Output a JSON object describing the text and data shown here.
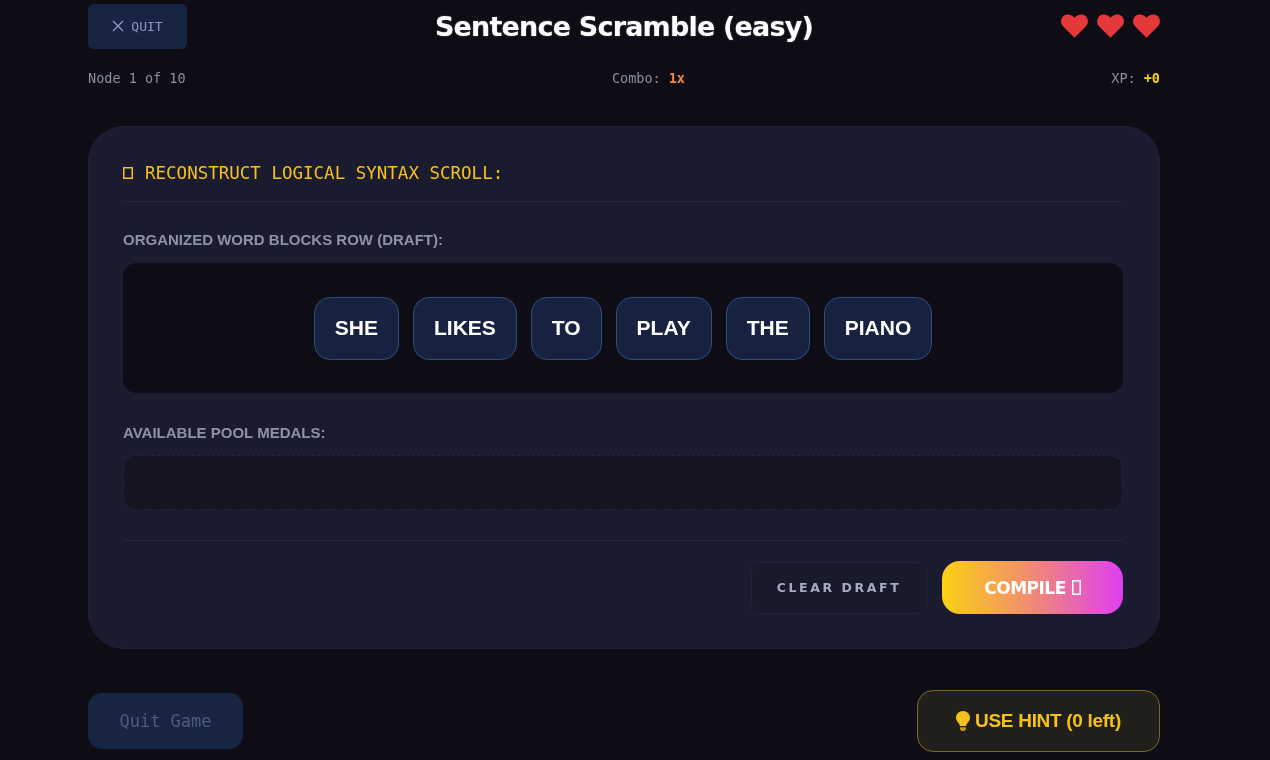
{
  "header": {
    "quit_button": "QUIT",
    "title": "Sentence Scramble (easy)",
    "lives": [
      {
        "filled": true
      },
      {
        "filled": true
      },
      {
        "filled": true
      }
    ]
  },
  "stats": {
    "node": "Node 1 of 10",
    "combo_label": "Combo:",
    "combo_value": "1x",
    "xp_label": "XP:",
    "xp_value": "+0"
  },
  "card": {
    "heading": "RECONSTRUCT LOGICAL SYNTAX SCROLL:",
    "draft_label": "ORGANIZED WORD BLOCKS ROW (DRAFT):",
    "draft_words": [
      "SHE",
      "LIKES",
      "TO",
      "PLAY",
      "THE",
      "PIANO"
    ],
    "pool_label": "AVAILABLE POOL MEDALS:",
    "clear_button": "CLEAR DRAFT",
    "compile_button": "COMPILE"
  },
  "footer": {
    "quit_button": "Quit Game",
    "hint_button": "USE HINT (0 left)"
  }
}
